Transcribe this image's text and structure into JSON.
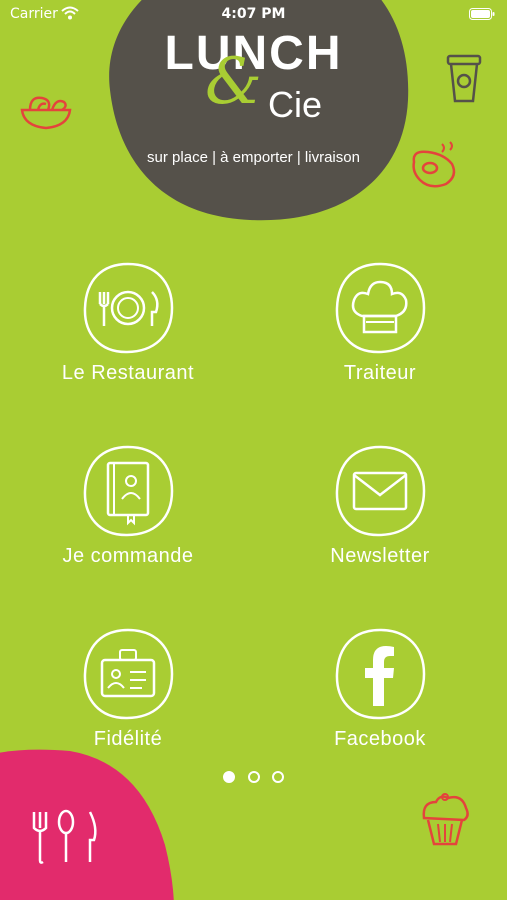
{
  "status_bar": {
    "carrier": "Carrier",
    "time": "4:07 PM"
  },
  "logo": {
    "name_top": "LUNCH",
    "ampersand": "&",
    "name_bottom": "Cie",
    "tagline": "sur place | à emporter | livraison"
  },
  "menu": [
    {
      "label": "Le Restaurant",
      "icon": "plate-cutlery-icon"
    },
    {
      "label": "Traiteur",
      "icon": "chef-hat-icon"
    },
    {
      "label": "Je commande",
      "icon": "order-book-icon"
    },
    {
      "label": "Newsletter",
      "icon": "envelope-icon"
    },
    {
      "label": "Fidélité",
      "icon": "loyalty-card-icon"
    },
    {
      "label": "Facebook",
      "icon": "facebook-icon"
    }
  ],
  "pagination": {
    "pages": 3,
    "current": 1
  },
  "colors": {
    "background": "#a9cd33",
    "logo_blob": "#55514a",
    "pink": "#e22b6c",
    "accent_red": "#e4443c",
    "text": "#ffffff"
  }
}
